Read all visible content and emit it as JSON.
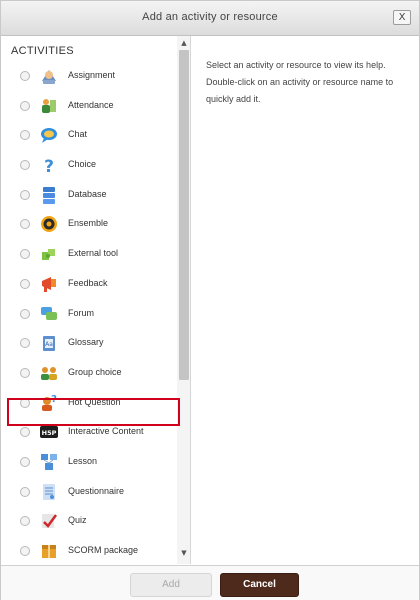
{
  "dialog": {
    "title": "Add an activity or resource",
    "close_label": "X",
    "section_heading": "ACTIVITIES",
    "help_text": "Select an activity or resource to view its help. Double-click on an activity or resource name to quickly add it."
  },
  "activities": [
    {
      "label": "Assignment",
      "icon": "assignment-icon"
    },
    {
      "label": "Attendance",
      "icon": "attendance-icon"
    },
    {
      "label": "Chat",
      "icon": "chat-icon"
    },
    {
      "label": "Choice",
      "icon": "choice-icon"
    },
    {
      "label": "Database",
      "icon": "database-icon"
    },
    {
      "label": "Ensemble",
      "icon": "ensemble-icon"
    },
    {
      "label": "External tool",
      "icon": "external-tool-icon"
    },
    {
      "label": "Feedback",
      "icon": "feedback-icon"
    },
    {
      "label": "Forum",
      "icon": "forum-icon"
    },
    {
      "label": "Glossary",
      "icon": "glossary-icon"
    },
    {
      "label": "Group choice",
      "icon": "group-choice-icon"
    },
    {
      "label": "Hot Question",
      "icon": "hot-question-icon"
    },
    {
      "label": "Interactive Content",
      "icon": "h5p-icon"
    },
    {
      "label": "Lesson",
      "icon": "lesson-icon"
    },
    {
      "label": "Questionnaire",
      "icon": "questionnaire-icon"
    },
    {
      "label": "Quiz",
      "icon": "quiz-icon"
    },
    {
      "label": "SCORM package",
      "icon": "scorm-package-icon"
    }
  ],
  "footer": {
    "add_label": "Add",
    "cancel_label": "Cancel"
  },
  "colors": {
    "highlight": "#d0021b",
    "cancel_button": "#4e2a1d"
  }
}
